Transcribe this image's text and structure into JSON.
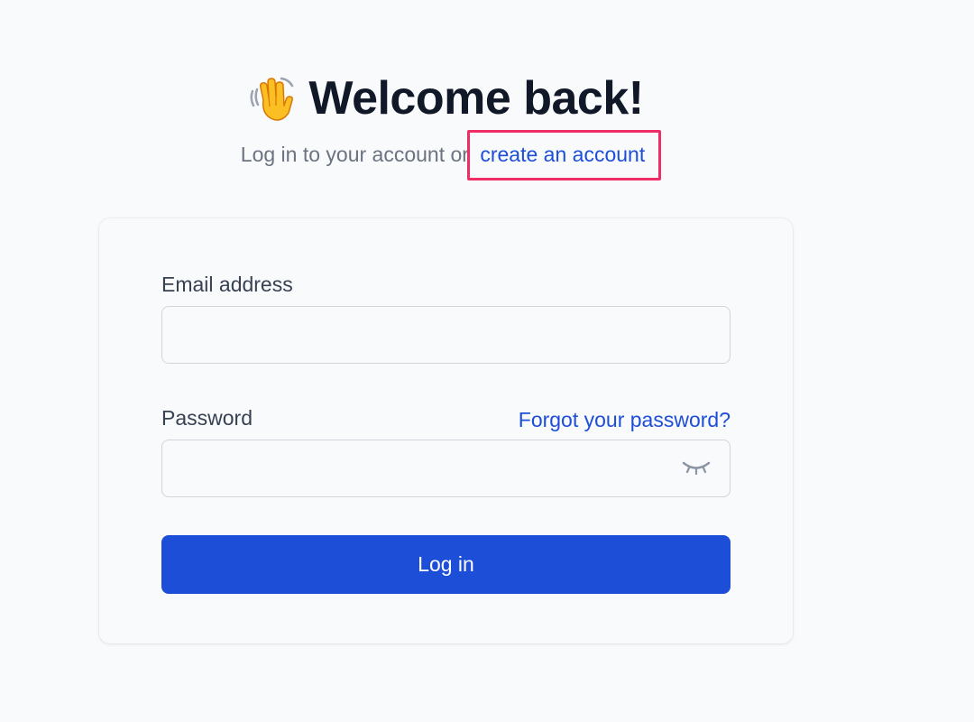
{
  "header": {
    "emoji_icon": "waving-hand-icon",
    "title": "Welcome back!",
    "subtitle_prefix": "Log in to your account or ",
    "create_account_link": "create an account"
  },
  "form": {
    "email_label": "Email address",
    "email_value": "",
    "password_label": "Password",
    "password_value": "",
    "forgot_password_link": "Forgot your password?",
    "visibility_icon": "eye-closed-icon",
    "submit_label": "Log in"
  },
  "colors": {
    "accent": "#1d4ed8",
    "highlight_box": "#ef2d66",
    "title_text": "#111827",
    "muted_text": "#6b7280",
    "background": "#f8fafc"
  }
}
